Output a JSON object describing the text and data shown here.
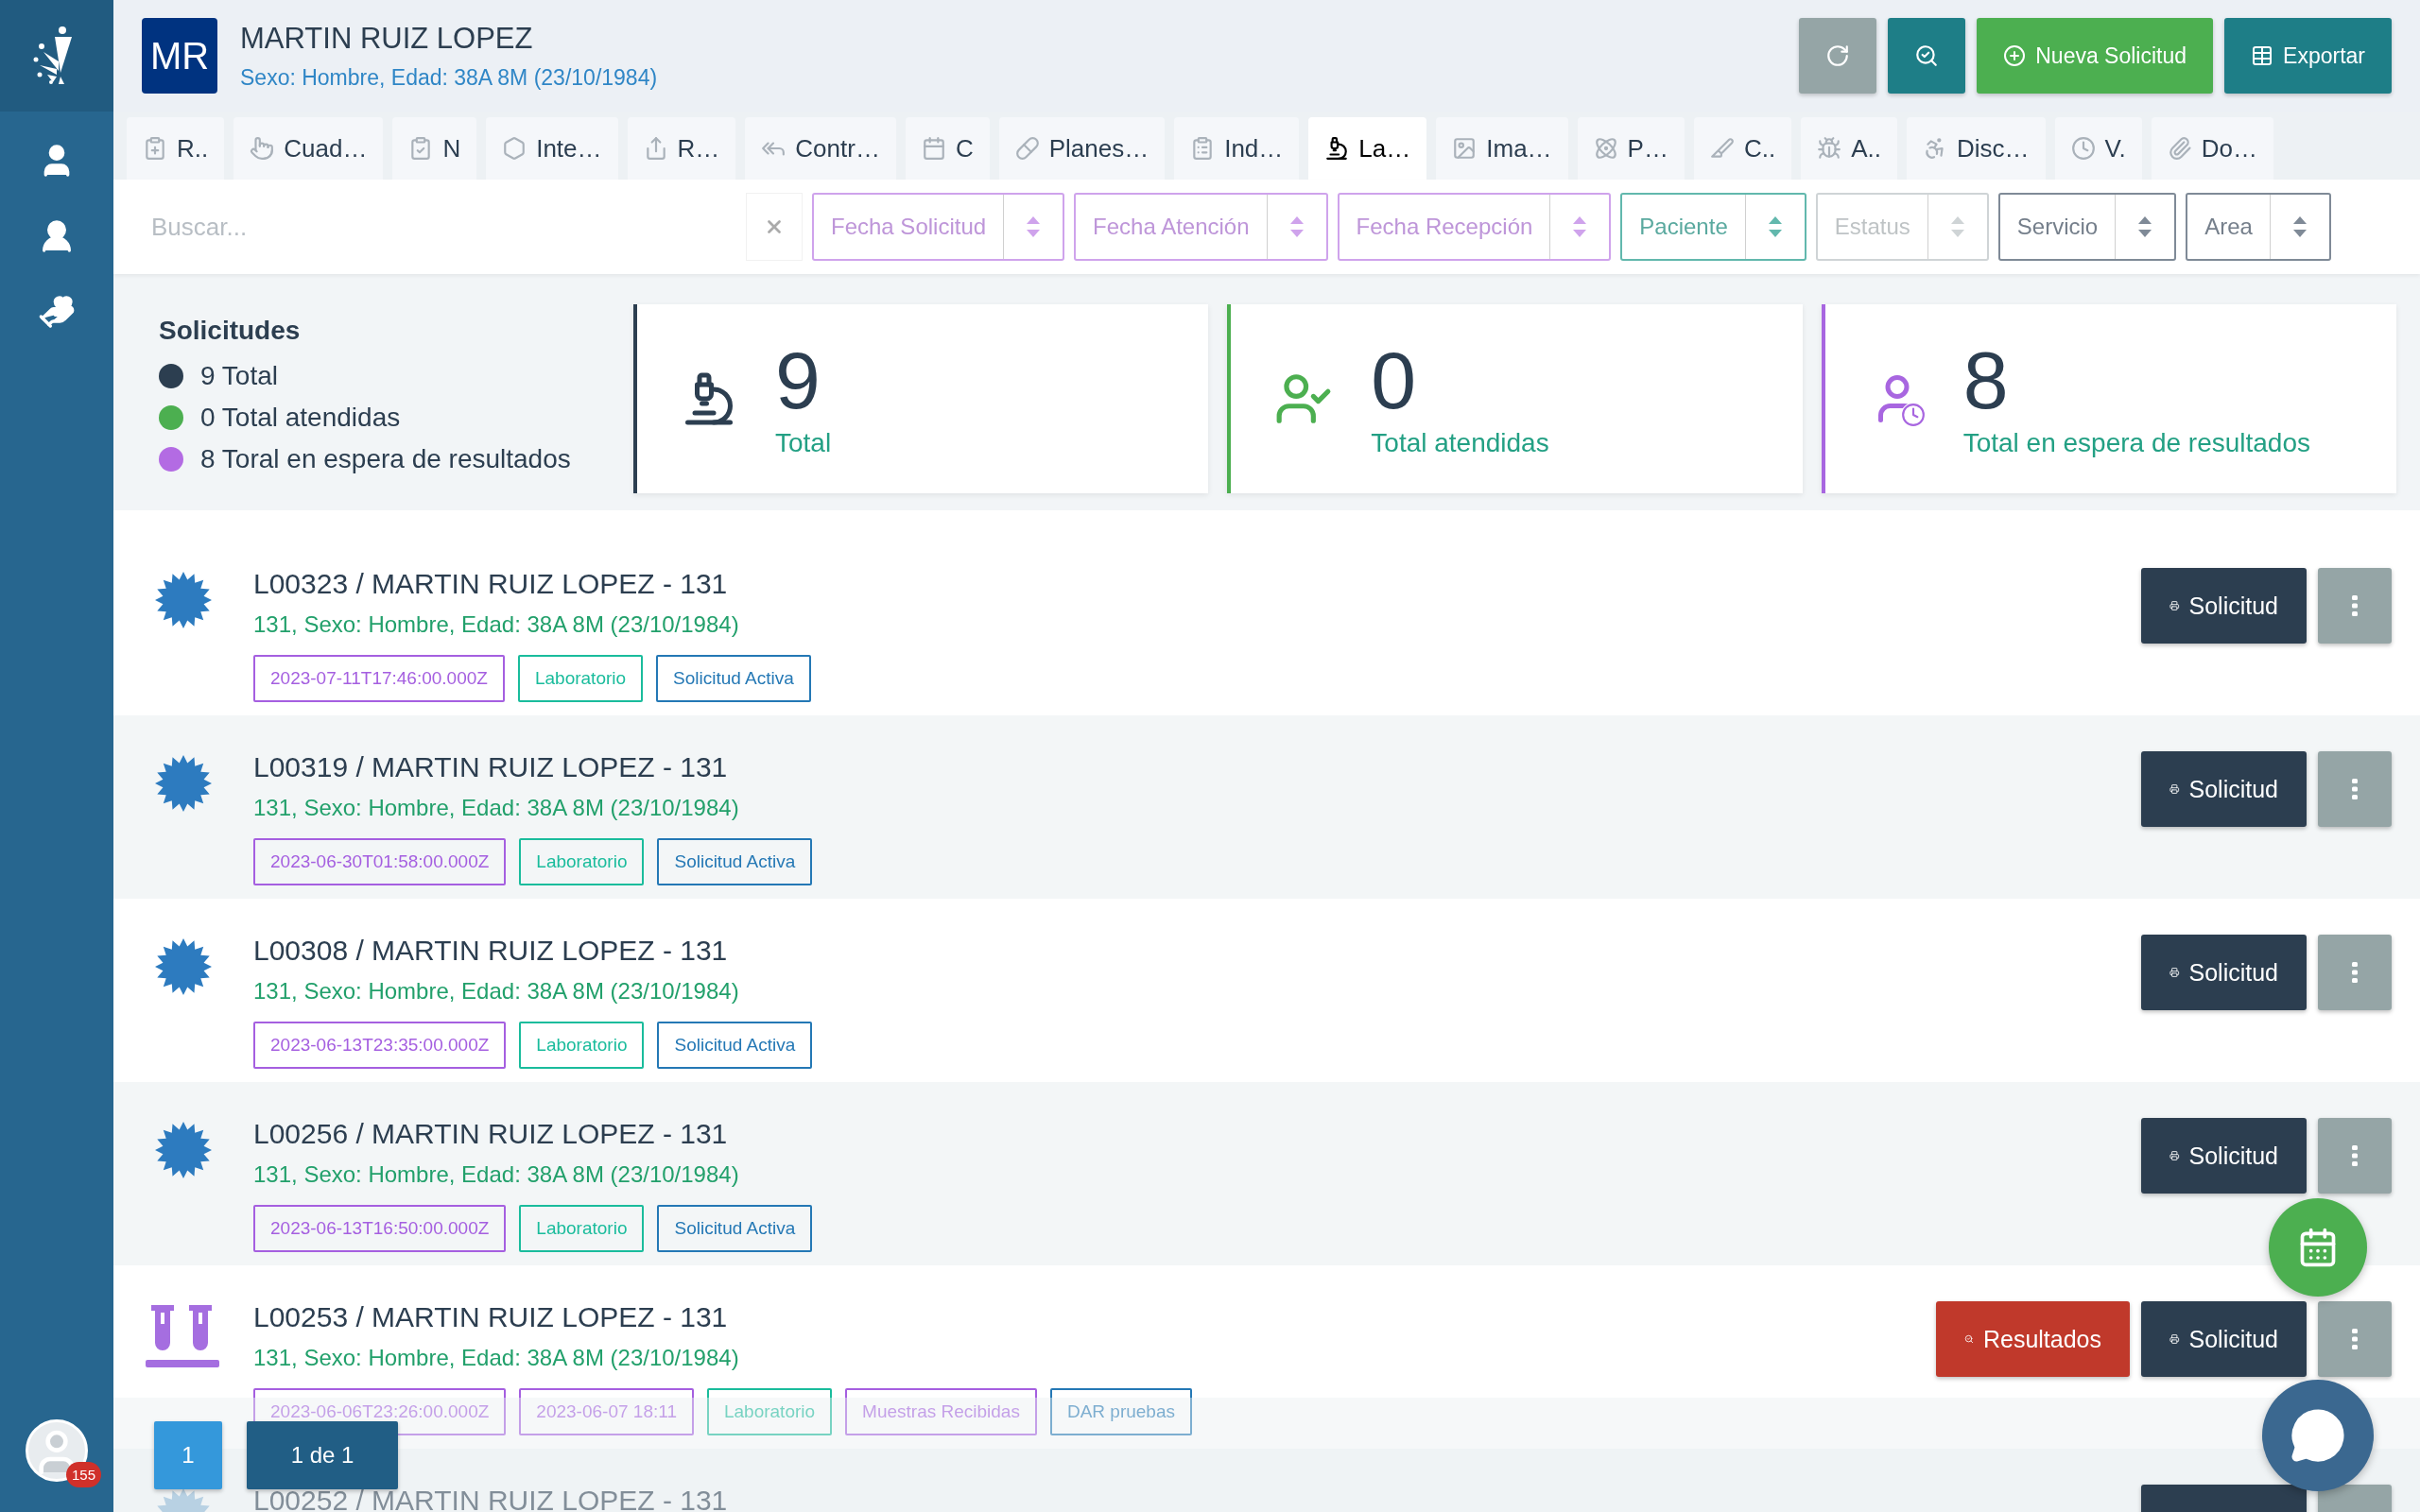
{
  "sidebar": {
    "items": [
      {
        "kind": "user"
      },
      {
        "kind": "nurse"
      },
      {
        "kind": "care"
      }
    ],
    "notification_count": "155"
  },
  "patient": {
    "initials": "MR",
    "name": "MARTIN RUIZ LOPEZ",
    "details": "Sexo: Hombre, Edad: 38A 8M (23/10/1984)"
  },
  "header_buttons": [
    {
      "kind": "refresh"
    },
    {
      "kind": "search"
    },
    {
      "kind": "new",
      "label": "Nueva Solicitud"
    },
    {
      "kind": "export",
      "label": "Exportar"
    }
  ],
  "tabs": [
    {
      "label": "R..",
      "selected": false
    },
    {
      "label": "Cuad…",
      "selected": false
    },
    {
      "label": "N",
      "selected": false
    },
    {
      "label": "Inte…",
      "selected": false
    },
    {
      "label": "R…",
      "selected": false
    },
    {
      "label": "Contr…",
      "selected": false
    },
    {
      "label": "C",
      "selected": false
    },
    {
      "label": "Planes…",
      "selected": false
    },
    {
      "label": "Ind…",
      "selected": false
    },
    {
      "label": "La…",
      "selected": true
    },
    {
      "label": "Ima…",
      "selected": false
    },
    {
      "label": "P…",
      "selected": false
    },
    {
      "label": "C..",
      "selected": false
    },
    {
      "label": "A..",
      "selected": false
    },
    {
      "label": "Disc…",
      "selected": false
    },
    {
      "label": "V.",
      "selected": false
    },
    {
      "label": "Do…",
      "selected": false
    }
  ],
  "filters": {
    "search": {
      "placeholder": "Buscar..."
    },
    "selects": [
      {
        "label": "Fecha Solicitud",
        "color": "#cfa3ec"
      },
      {
        "label": "Fecha Atención",
        "color": "#cfa3ec"
      },
      {
        "label": "Fecha Recepción",
        "color": "#cfa3ec"
      },
      {
        "label": "Paciente",
        "color": "#62b8ad"
      },
      {
        "label": "Estatus",
        "color": "#cfd4d6"
      },
      {
        "label": "Servicio",
        "color": "#7f8a97"
      },
      {
        "label": "Area",
        "color": "#7f8a97"
      }
    ]
  },
  "summary": {
    "title": "Solicitudes",
    "legend": [
      {
        "text": "9 Total",
        "color": "#2c3e50"
      },
      {
        "text": "0 Total atendidas",
        "color": "#4caf50"
      },
      {
        "text": "8 Toral en espera de resultados",
        "color": "#b36be3"
      }
    ],
    "cards": [
      {
        "kind": "total",
        "value": "9",
        "label": "Total",
        "color": "#2c3e50"
      },
      {
        "kind": "attended",
        "value": "0",
        "label": "Total atendidas",
        "color": "#4caf50"
      },
      {
        "kind": "waiting",
        "value": "8",
        "label": "Total en espera de resultados",
        "color": "#a866e0"
      }
    ]
  },
  "requests": [
    {
      "kind": "seal",
      "title": "L00323 / MARTIN RUIZ LOPEZ - 131",
      "details": "131, Sexo: Hombre, Edad: 38A 8M (23/10/1984)",
      "tags": [
        {
          "text": "2023-07-11T17:46:00.000Z",
          "color": "#a55fe0"
        },
        {
          "text": "Laboratorio",
          "color": "#1abc9c"
        },
        {
          "text": "Solicitud Activa",
          "color": "#2478b5"
        }
      ],
      "actions": [
        {
          "kind": "request",
          "label": "Solicitud"
        },
        {
          "kind": "menu"
        }
      ]
    },
    {
      "kind": "seal",
      "title": "L00319 / MARTIN RUIZ LOPEZ - 131",
      "details": "131, Sexo: Hombre, Edad: 38A 8M (23/10/1984)",
      "tags": [
        {
          "text": "2023-06-30T01:58:00.000Z",
          "color": "#a55fe0"
        },
        {
          "text": "Laboratorio",
          "color": "#1abc9c"
        },
        {
          "text": "Solicitud Activa",
          "color": "#2478b5"
        }
      ],
      "actions": [
        {
          "kind": "request",
          "label": "Solicitud"
        },
        {
          "kind": "menu"
        }
      ]
    },
    {
      "kind": "seal",
      "title": "L00308 / MARTIN RUIZ LOPEZ - 131",
      "details": "131, Sexo: Hombre, Edad: 38A 8M (23/10/1984)",
      "tags": [
        {
          "text": "2023-06-13T23:35:00.000Z",
          "color": "#a55fe0"
        },
        {
          "text": "Laboratorio",
          "color": "#1abc9c"
        },
        {
          "text": "Solicitud Activa",
          "color": "#2478b5"
        }
      ],
      "actions": [
        {
          "kind": "request",
          "label": "Solicitud"
        },
        {
          "kind": "menu"
        }
      ]
    },
    {
      "kind": "seal",
      "title": "L00256 / MARTIN RUIZ LOPEZ - 131",
      "details": "131, Sexo: Hombre, Edad: 38A 8M (23/10/1984)",
      "tags": [
        {
          "text": "2023-06-13T16:50:00.000Z",
          "color": "#a55fe0"
        },
        {
          "text": "Laboratorio",
          "color": "#1abc9c"
        },
        {
          "text": "Solicitud Activa",
          "color": "#2478b5"
        }
      ],
      "actions": [
        {
          "kind": "request",
          "label": "Solicitud"
        },
        {
          "kind": "menu"
        }
      ]
    },
    {
      "kind": "tubes",
      "title": "L00253 / MARTIN RUIZ LOPEZ - 131",
      "details": "131, Sexo: Hombre, Edad: 38A 8M (23/10/1984)",
      "tags": [
        {
          "text": "2023-06-06T23:26:00.000Z",
          "color": "#a55fe0"
        },
        {
          "text": "2023-06-07 18:11",
          "color": "#a55fe0"
        },
        {
          "text": "Laboratorio",
          "color": "#1abc9c"
        },
        {
          "text": "Muestras Recibidas",
          "color": "#a55fe0"
        },
        {
          "text": "DAR pruebas",
          "color": "#2478b5"
        }
      ],
      "actions": [
        {
          "kind": "results",
          "label": "Resultados"
        },
        {
          "kind": "request",
          "label": "Solicitud"
        },
        {
          "kind": "menu"
        }
      ]
    },
    {
      "kind": "seal",
      "title": "L00252 / MARTIN RUIZ LOPEZ - 131",
      "actions": [
        {
          "kind": "request"
        },
        {
          "kind": "menu"
        }
      ]
    }
  ],
  "pagination": {
    "pages": [
      {
        "label": "1",
        "selected": true
      }
    ],
    "summary": "1 de 1"
  },
  "floating_buttons": [
    {
      "kind": "calendar"
    },
    {
      "kind": "chat"
    }
  ]
}
